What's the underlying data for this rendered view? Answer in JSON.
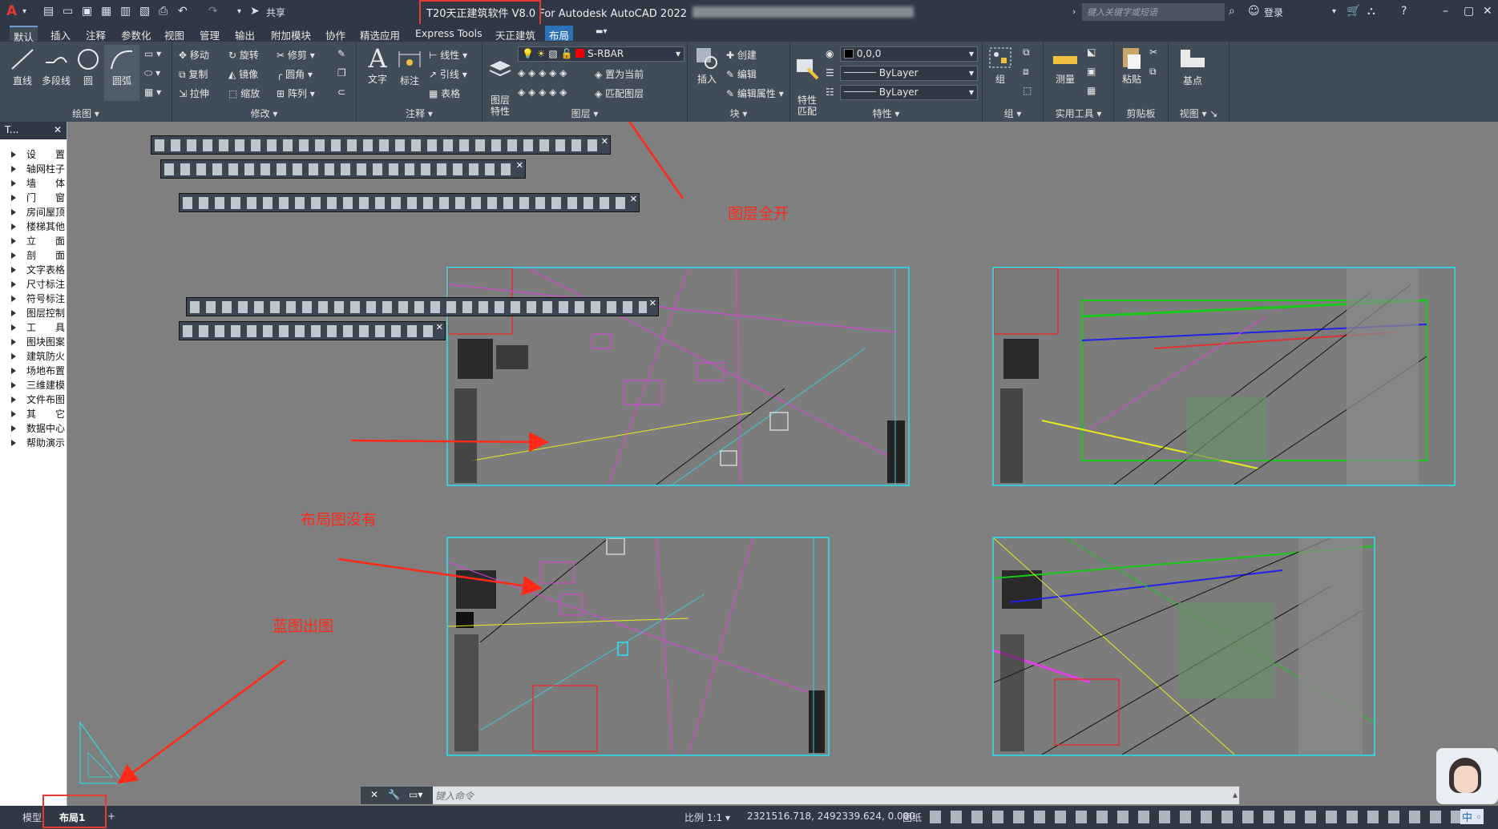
{
  "titlebar": {
    "app_title": "T20天正建筑软件 V8.0 For Autodesk AutoCAD 2022",
    "share_label": "共享",
    "search_placeholder": "键入关键字或短语",
    "login_label": "登录"
  },
  "ribbon_tabs": [
    "默认",
    "插入",
    "注释",
    "参数化",
    "视图",
    "管理",
    "输出",
    "附加模块",
    "协作",
    "精选应用",
    "Express Tools",
    "天正建筑",
    "布局"
  ],
  "ribbon": {
    "draw": {
      "label": "绘图",
      "line": "直线",
      "polyline": "多段线",
      "circle": "圆",
      "arc": "圆弧"
    },
    "modify": {
      "label": "修改",
      "move": "移动",
      "rotate": "旋转",
      "trim": "修剪",
      "copy": "复制",
      "mirror": "镜像",
      "fillet": "圆角",
      "stretch": "拉伸",
      "scale": "缩放",
      "array": "阵列"
    },
    "annotation": {
      "label": "注释",
      "text": "文字",
      "dimension": "标注",
      "linear": "线性",
      "leader": "引线",
      "table": "表格"
    },
    "layers": {
      "label": "图层",
      "layer_props": "图层\n特性",
      "current_layer": "S-RBAR",
      "set_current": "置为当前",
      "match_layer": "匹配图层"
    },
    "block": {
      "label": "块",
      "insert": "插入",
      "create": "创建",
      "edit": "编辑",
      "edit_attr": "编辑属性"
    },
    "properties": {
      "label": "特性",
      "match": "特性\n匹配",
      "color_value": "0,0,0",
      "linetype": "ByLayer",
      "lineweight": "ByLayer"
    },
    "groups": {
      "label": "组",
      "group": "组"
    },
    "utilities": {
      "label": "实用工具",
      "measure": "测量"
    },
    "clipboard": {
      "label": "剪贴板",
      "paste": "粘贴"
    },
    "view": {
      "label": "视图",
      "base": "基点"
    }
  },
  "left_panel": {
    "header": "T...",
    "items": [
      "设　　置",
      "轴网柱子",
      "墙　　体",
      "门　　窗",
      "房间屋顶",
      "楼梯其他",
      "立　　面",
      "剖　　面",
      "文字表格",
      "尺寸标注",
      "符号标注",
      "图层控制",
      "工　　具",
      "图块图案",
      "建筑防火",
      "场地布置",
      "三维建模",
      "文件布图",
      "其　　它",
      "数据中心",
      "帮助演示"
    ]
  },
  "annotations": {
    "layers_all_on": "图层全开",
    "layout_missing": "布局图没有",
    "blueprint_output": "蓝图出图"
  },
  "command_line": {
    "placeholder": "键入命令"
  },
  "statusbar": {
    "model_tab": "模型",
    "layout_tab": "布局1",
    "scale": "比例 1:1",
    "coordinates": "2321516.718, 2492339.624, 0.000",
    "paper": "图纸"
  },
  "colors": {
    "annotation_red": "#ff2a1a",
    "sheet_border": "#3cc9d6",
    "ribbon_bg": "#414c59",
    "title_bg": "#2f3844"
  }
}
